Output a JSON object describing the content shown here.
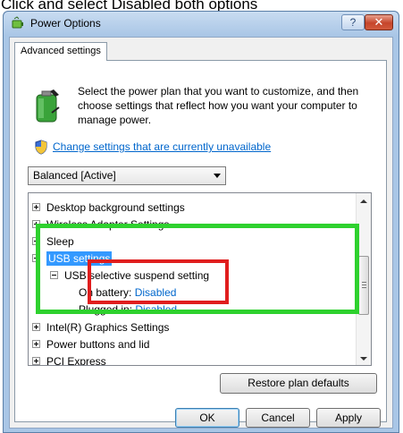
{
  "caption": "Click and select Disabled both options",
  "window": {
    "title": "Power Options",
    "help_label": "?",
    "close_label": "✕"
  },
  "tab": {
    "label": "Advanced settings"
  },
  "intro": {
    "text": "Select the power plan that you want to customize, and then choose settings that reflect how you want your computer to manage power."
  },
  "link": {
    "label": "Change settings that are currently unavailable"
  },
  "plan_select": {
    "value": "Balanced [Active]"
  },
  "tree": {
    "items": [
      {
        "label": "Desktop background settings"
      },
      {
        "label": "Wireless Adapter Settings"
      },
      {
        "label": "Sleep"
      },
      {
        "label": "USB settings"
      },
      {
        "label": "USB selective suspend setting"
      },
      {
        "label": "On battery:",
        "value": "Disabled"
      },
      {
        "label": "Plugged in:",
        "value": "Disabled"
      },
      {
        "label": "Intel(R) Graphics Settings"
      },
      {
        "label": "Power buttons and lid"
      },
      {
        "label": "PCI Express"
      }
    ]
  },
  "buttons": {
    "restore": "Restore plan defaults",
    "ok": "OK",
    "cancel": "Cancel",
    "apply": "Apply"
  },
  "colors": {
    "selection": "#3399ff",
    "link": "#0066cc",
    "highlight_green": "#2ed12e",
    "highlight_red": "#e01e1e"
  }
}
